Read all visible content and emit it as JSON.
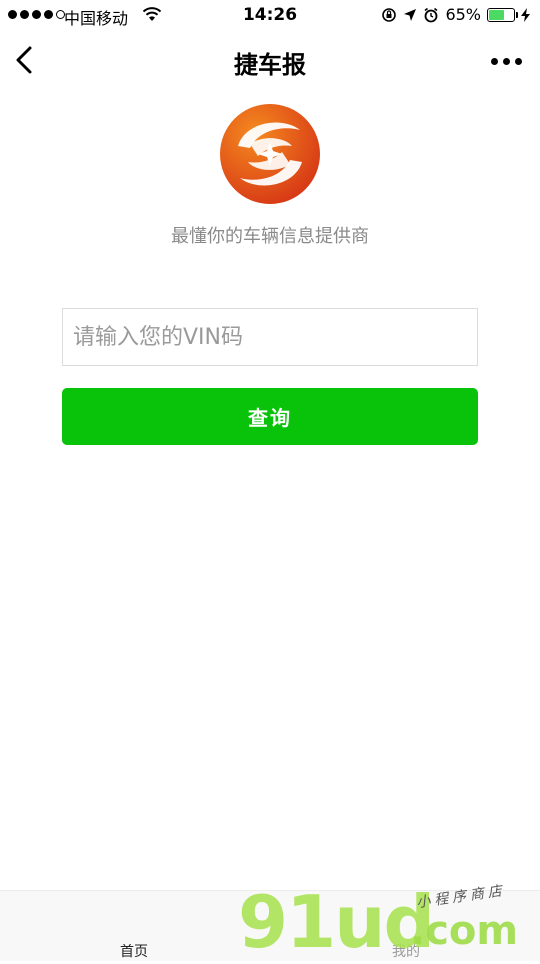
{
  "status_bar": {
    "carrier": "中国移动",
    "time": "14:26",
    "battery_percent": "65%",
    "battery_level": 0.65,
    "battery_color": "#4cd964"
  },
  "nav": {
    "title": "捷车报",
    "back_icon": "chevron-left-icon",
    "more_icon": "more-dots-icon"
  },
  "brand": {
    "slogan": "最懂你的车辆信息提供商",
    "logo_colors": [
      "#f07a1a",
      "#d83a16"
    ]
  },
  "form": {
    "vin_placeholder": "请输入您的VIN码",
    "vin_value": "",
    "query_label": "查询",
    "button_color": "#09c30a"
  },
  "tab_bar": {
    "home_label": "首页",
    "mine_label": "我的"
  },
  "watermark": {
    "big": "91ud",
    "com": ".com",
    "small": "小程序商店"
  }
}
